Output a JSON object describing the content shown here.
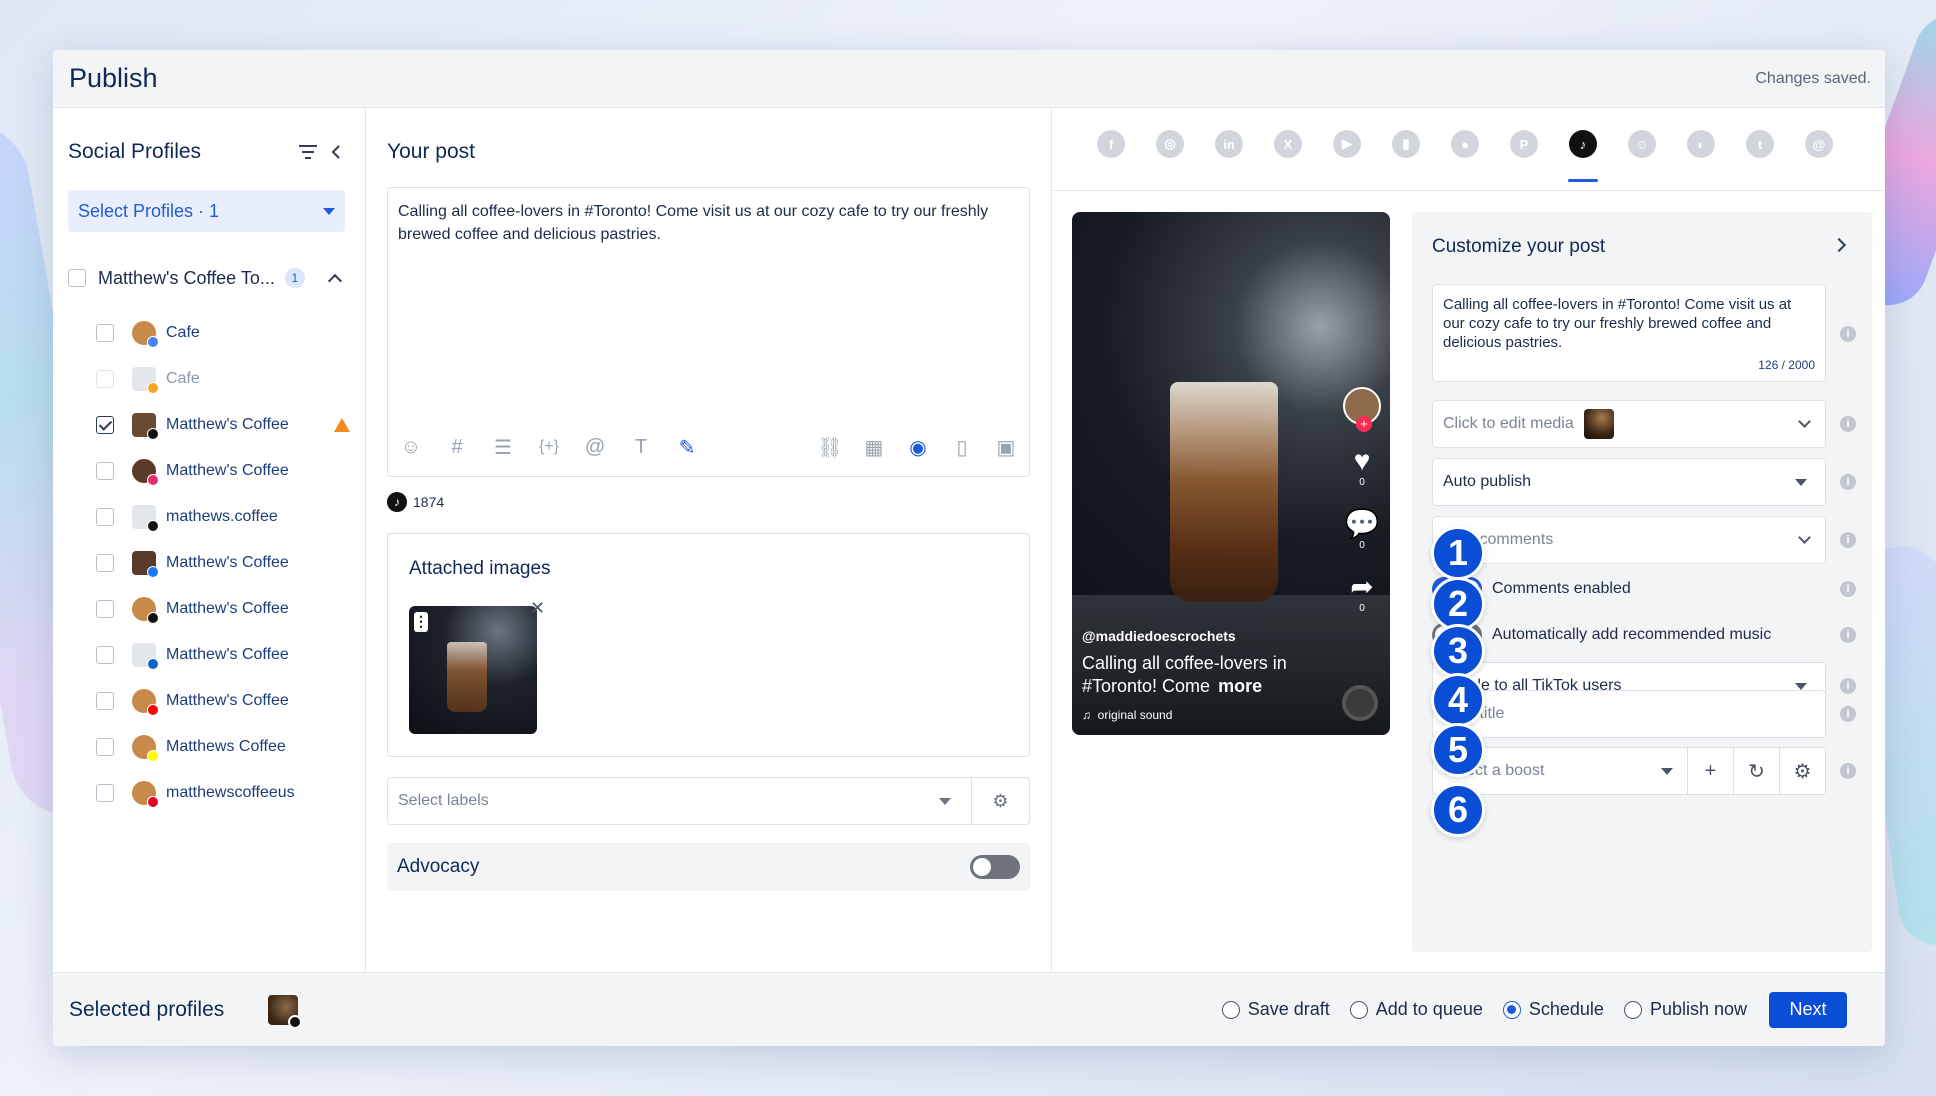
{
  "header": {
    "title": "Publish",
    "status": "Changes saved."
  },
  "profiles": {
    "heading": "Social Profiles",
    "select_label": "Select Profiles · 1",
    "group": {
      "name": "Matthew's Coffee To...",
      "count": "1"
    },
    "items": [
      {
        "label": "Cafe",
        "network": "google",
        "checked": false,
        "dim": false
      },
      {
        "label": "Cafe",
        "network": "building",
        "checked": false,
        "dim": true
      },
      {
        "label": "Matthew's Coffee",
        "network": "tiktok",
        "checked": true,
        "dim": false,
        "warning": true
      },
      {
        "label": "Matthew's Coffee",
        "network": "instagram",
        "checked": false,
        "dim": false
      },
      {
        "label": "mathews.coffee",
        "network": "threads",
        "checked": false,
        "dim": false
      },
      {
        "label": "Matthew's Coffee",
        "network": "facebook",
        "checked": false,
        "dim": false
      },
      {
        "label": "Matthew's Coffee",
        "network": "x",
        "checked": false,
        "dim": false
      },
      {
        "label": "Matthew's Coffee",
        "network": "linkedin",
        "checked": false,
        "dim": false
      },
      {
        "label": "Matthew's Coffee",
        "network": "youtube",
        "checked": false,
        "dim": false
      },
      {
        "label": "Matthews Coffee",
        "network": "snapchat",
        "checked": false,
        "dim": false
      },
      {
        "label": "matthewscoffeeus",
        "network": "pinterest",
        "checked": false,
        "dim": false
      }
    ]
  },
  "post": {
    "heading": "Your post",
    "text": "Calling all coffee-lovers in #Toronto! Come visit us at our cozy cafe to try our freshly brewed coffee and delicious pastries.",
    "char_count": "1874",
    "attached_heading": "Attached images",
    "labels_placeholder": "Select labels",
    "advocacy_label": "Advocacy"
  },
  "preview": {
    "networks": [
      "facebook",
      "instagram",
      "linkedin",
      "x",
      "youtube",
      "gbp",
      "reddit",
      "pinterest",
      "tiktok",
      "snapchat",
      "threads-alt",
      "tumblr",
      "threads"
    ],
    "active_network": "tiktok",
    "handle": "@maddiedoescrochets",
    "caption": "Calling all coffee-lovers in #Toronto! Come",
    "more": "more",
    "sound": "original sound",
    "likes": "0",
    "comments": "0",
    "shares": "0"
  },
  "customize": {
    "heading": "Customize your post",
    "text": "Calling all coffee-lovers in #Toronto! Come visit us at our cozy cafe to try our freshly brewed coffee and delicious pastries.",
    "count": "126 / 2000",
    "media_placeholder": "Click to edit media",
    "publish_mode": "Auto publish",
    "comments_placeholder": "Post comments",
    "comments_enabled": "Comments enabled",
    "music_label": "Automatically add recommended music",
    "visibility": "Visible to all TikTok users",
    "title_placeholder": "Post title",
    "boost_placeholder": "Select a boost",
    "callouts": [
      "1",
      "2",
      "3",
      "4",
      "5",
      "6"
    ]
  },
  "footer": {
    "selected_label": "Selected profiles",
    "options": [
      {
        "label": "Save draft",
        "selected": false
      },
      {
        "label": "Add to queue",
        "selected": false
      },
      {
        "label": "Schedule",
        "selected": true
      },
      {
        "label": "Publish now",
        "selected": false
      }
    ],
    "next_label": "Next"
  },
  "colors": {
    "accent": "#0a4ed6",
    "tiktok": "#111111",
    "warning": "#f08c1e"
  }
}
